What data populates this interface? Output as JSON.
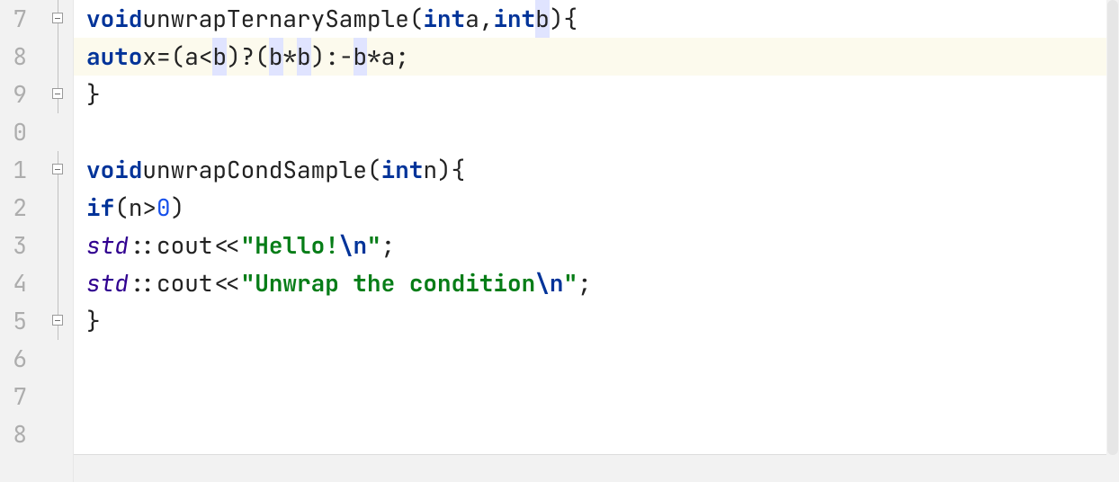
{
  "line_numbers": [
    "7",
    "8",
    "9",
    "0",
    "1",
    "2",
    "3",
    "4",
    "5",
    "6",
    "7",
    "8"
  ],
  "fold": {
    "lines": [
      true,
      true,
      true,
      false,
      true,
      true,
      true,
      true,
      true,
      false,
      false,
      false
    ],
    "markers": [
      {
        "row": 0,
        "pos": "top"
      },
      {
        "row": 2,
        "pos": "bot"
      },
      {
        "row": 4,
        "pos": "top"
      },
      {
        "row": 8,
        "pos": "bot"
      }
    ]
  },
  "code": {
    "line7": {
      "kw_void": "void",
      "fn": "unwrapTernarySample",
      "p_open": "(",
      "kw_int1": "int",
      "param_a": "a",
      "comma": ",",
      "kw_int2": "int",
      "param_b": "b",
      "p_close": ")",
      "brace_open": "{"
    },
    "line8": {
      "kw_auto": "auto",
      "x": "x",
      "eq": "=",
      "p1": "(",
      "a1": "a",
      "lt": "<",
      "b1": "b",
      "p1c": ")",
      "q": "?",
      "p2": "(",
      "b2": "b",
      "star1": "*",
      "b3": "b",
      "p2c": ")",
      "colon": ":",
      "minus": "-",
      "b4": "b",
      "star2": "*",
      "a2": "a",
      "semi": ";"
    },
    "line9": {
      "brace_close": "}"
    },
    "line11": {
      "kw_void": "void",
      "fn": "unwrapCondSample",
      "p_open": "(",
      "kw_int": "int",
      "param_n": "n",
      "p_close": ")",
      "brace_open": "{"
    },
    "line12": {
      "kw_if": "if",
      "p_open": "(",
      "n": "n",
      "gt": ">",
      "zero": "0",
      "p_close": ")"
    },
    "line13": {
      "ns": "std",
      "sc": "::",
      "cout": "cout",
      "lshift": "<<",
      "q1": "\"",
      "s": "Hello!",
      "esc": "\\n",
      "q2": "\"",
      "semi": ";"
    },
    "line14": {
      "ns": "std",
      "sc": "::",
      "cout": "cout",
      "lshift": "<<",
      "q1": "\"",
      "s": "Unwrap the condition",
      "esc": "\\n",
      "q2": "\"",
      "semi": ";"
    },
    "line15": {
      "brace_close": "}"
    }
  },
  "colors": {
    "highlight_bg": "#fcfaed",
    "selection_bg": "#e0e4ff",
    "keyword": "#003399",
    "string": "#067d17",
    "number": "#1750eb",
    "namespace": "#300090"
  }
}
